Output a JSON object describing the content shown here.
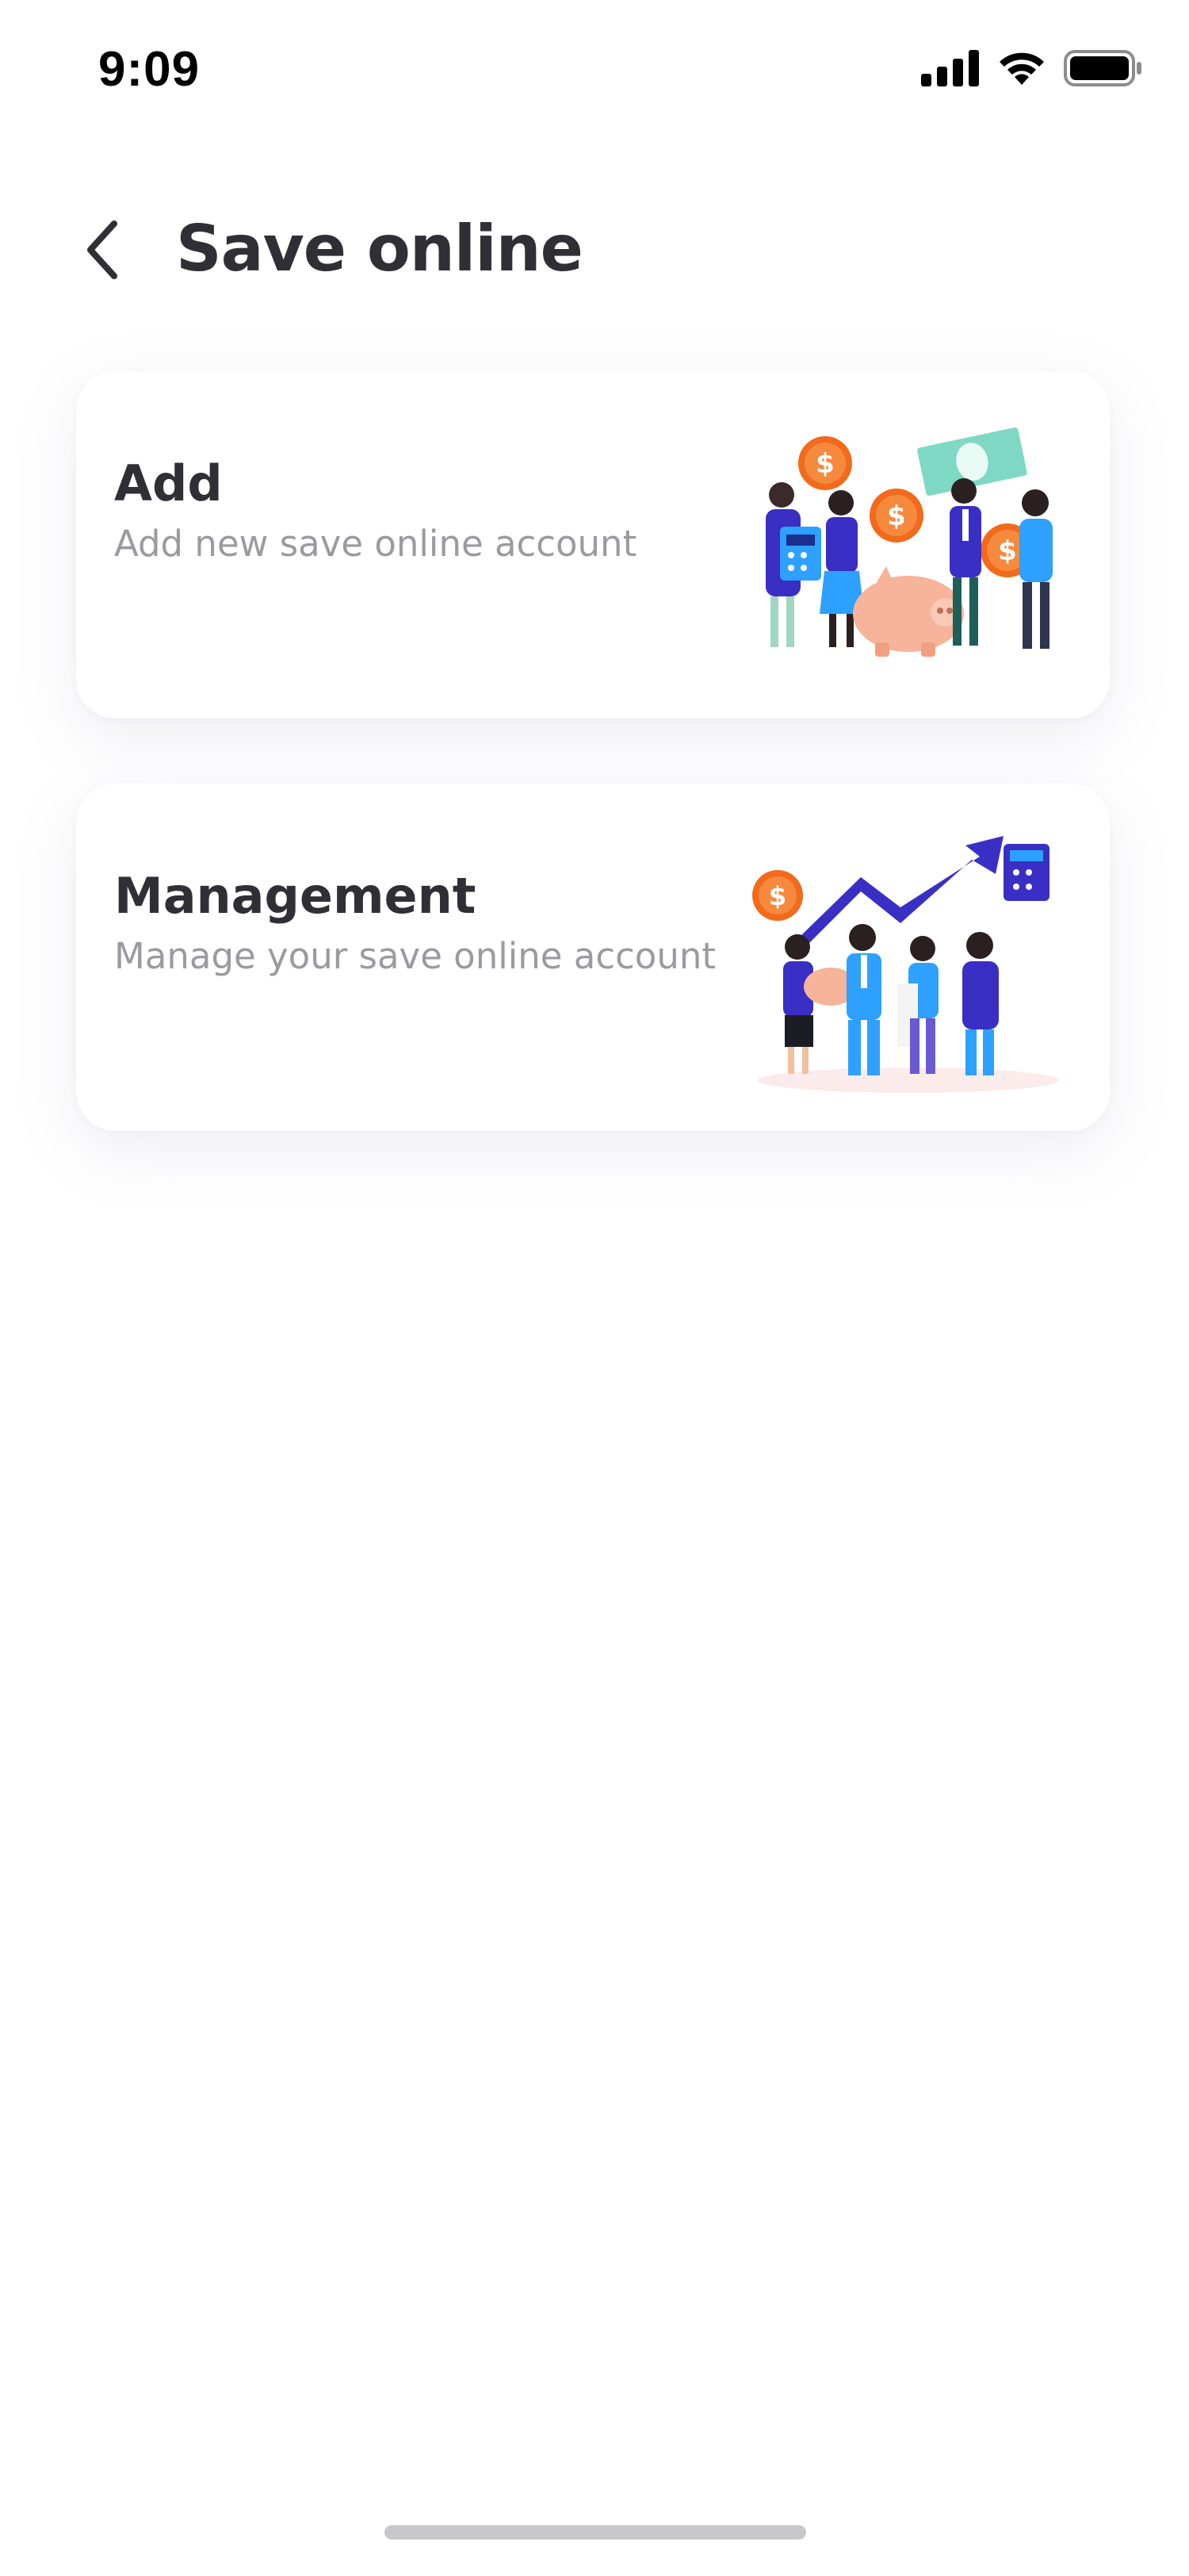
{
  "status_bar": {
    "time": "9:09",
    "icons": [
      "cellular-signal-icon",
      "wifi-icon",
      "battery-icon"
    ]
  },
  "header": {
    "back_icon": "chevron-left-icon",
    "title": "Save online"
  },
  "cards": [
    {
      "title": "Add",
      "subtitle": "Add new save online account",
      "illustration": "people-savings-piggy-bank-illustration"
    },
    {
      "title": "Management",
      "subtitle": "Manage your save online account",
      "illustration": "people-growth-chart-illustration"
    }
  ],
  "colors": {
    "text_primary": "#2f2f35",
    "text_secondary": "#9a9aa0",
    "accent_blue": "#3a2fc4",
    "accent_orange": "#f26a1b",
    "accent_teal": "#7fd8c4",
    "piggy_pink": "#f6b49a",
    "home_indicator": "#c7c7cc"
  }
}
